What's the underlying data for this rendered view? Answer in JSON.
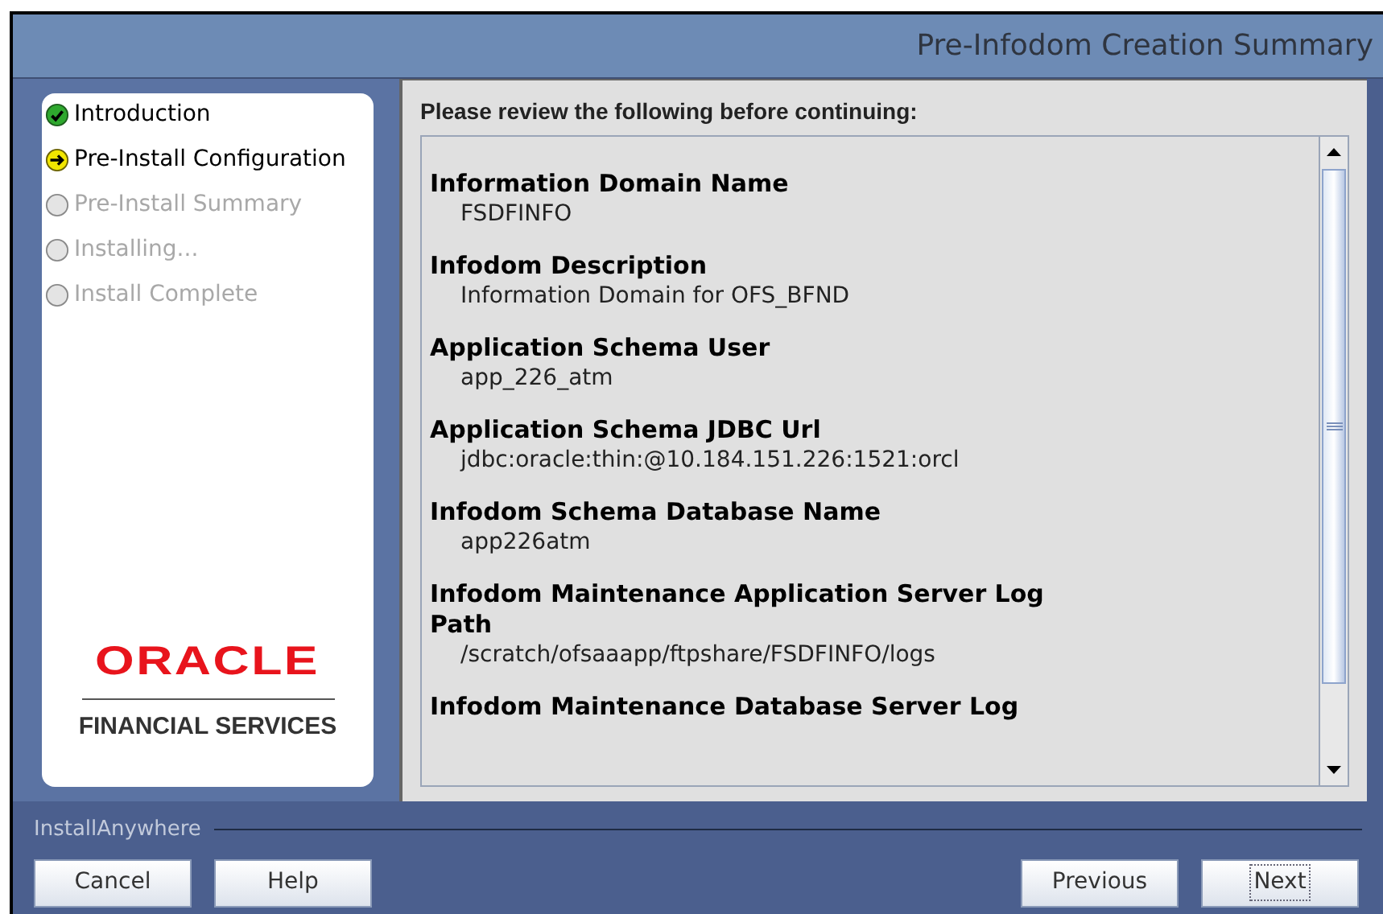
{
  "window": {
    "title": "Pre-Infodom Creation Summary"
  },
  "steps": [
    {
      "label": "Introduction",
      "kind": "done"
    },
    {
      "label": "Pre-Install Configuration",
      "kind": "current"
    },
    {
      "label": "Pre-Install Summary",
      "kind": "pending"
    },
    {
      "label": "Installing...",
      "kind": "pending"
    },
    {
      "label": "Install Complete",
      "kind": "pending"
    }
  ],
  "logo": {
    "brand": "ORACLE",
    "tagline": "FINANCIAL SERVICES"
  },
  "content": {
    "intro": "Please review the following before continuing:",
    "items": [
      {
        "label": "Information Domain Name",
        "value": "FSDFINFO"
      },
      {
        "label": "Infodom Description",
        "value": "Information Domain for OFS_BFND"
      },
      {
        "label": "Application Schema User",
        "value": "app_226_atm"
      },
      {
        "label": "Application Schema JDBC Url",
        "value": "jdbc:oracle:thin:@10.184.151.226:1521:orcl"
      },
      {
        "label": "Infodom Schema Database Name",
        "value": "app226atm"
      },
      {
        "label": "Infodom Maintenance Application Server Log Path",
        "value": "/scratch/ofsaaapp/ftpshare/FSDFINFO/logs"
      },
      {
        "label": "Infodom Maintenance Database Server Log"
      }
    ]
  },
  "footer": {
    "label": "InstallAnywhere"
  },
  "buttons_left": [
    {
      "label": "Cancel",
      "focused": false
    },
    {
      "label": "Help",
      "focused": false
    }
  ],
  "buttons_right": [
    {
      "label": "Previous",
      "focused": false
    },
    {
      "label": "Next",
      "focused": true
    }
  ]
}
